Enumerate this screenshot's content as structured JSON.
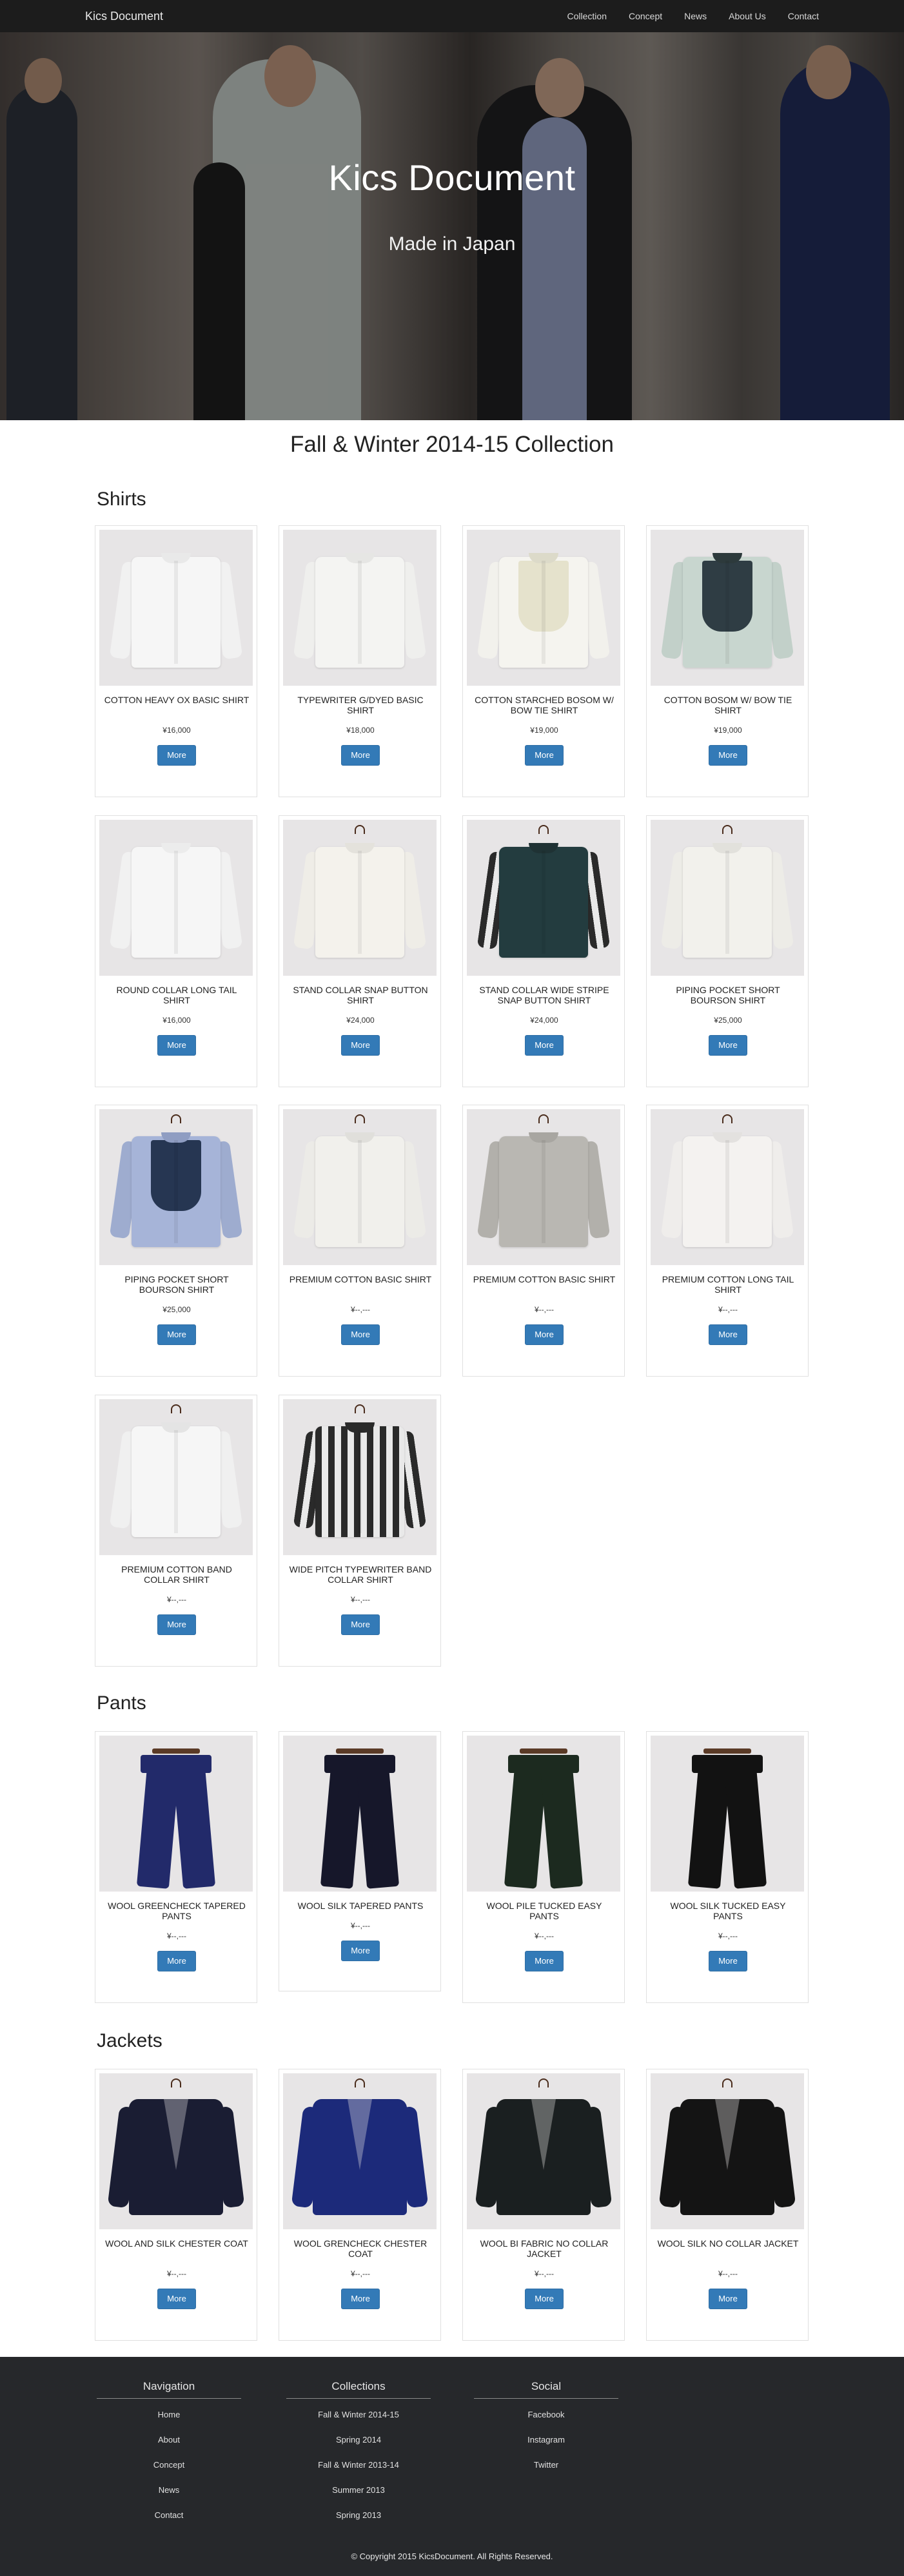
{
  "nav": {
    "brand": "Kics Document",
    "links": [
      "Collection",
      "Concept",
      "News",
      "About Us",
      "Contact"
    ]
  },
  "hero": {
    "title": "Kics Document",
    "subtitle": "Made in Japan"
  },
  "collection_title": "Fall & Winter 2014-15 Collection",
  "sections": {
    "shirts": {
      "heading": "Shirts",
      "items": [
        {
          "name": "COTTON HEAVY OX BASIC SHIRT",
          "price": "¥16,000",
          "button": "More"
        },
        {
          "name": "TYPEWRITER G/DYED BASIC SHIRT",
          "price": "¥18,000",
          "button": "More"
        },
        {
          "name": "COTTON STARCHED BOSOM W/ BOW TIE SHIRT",
          "price": "¥19,000",
          "button": "More"
        },
        {
          "name": "COTTON BOSOM W/ BOW TIE SHIRT",
          "price": "¥19,000",
          "button": "More"
        },
        {
          "name": "ROUND COLLAR LONG TAIL SHIRT",
          "price": "¥16,000",
          "button": "More"
        },
        {
          "name": "STAND COLLAR SNAP BUTTON SHIRT",
          "price": "¥24,000",
          "button": "More"
        },
        {
          "name": "STAND COLLAR WIDE STRIPE SNAP BUTTON SHIRT",
          "price": "¥24,000",
          "button": "More"
        },
        {
          "name": "PIPING POCKET SHORT BOURSON SHIRT",
          "price": "¥25,000",
          "button": "More"
        },
        {
          "name": "PIPING POCKET SHORT BOURSON SHIRT",
          "price": "¥25,000",
          "button": "More"
        },
        {
          "name": "PREMIUM COTTON BASIC SHIRT",
          "price": "¥--,---",
          "button": "More"
        },
        {
          "name": "PREMIUM COTTON BASIC SHIRT",
          "price": "¥--,---",
          "button": "More"
        },
        {
          "name": "PREMIUM COTTON LONG TAIL SHIRT",
          "price": "¥--,---",
          "button": "More"
        },
        {
          "name": "PREMIUM COTTON BAND COLLAR SHIRT",
          "price": "¥--,---",
          "button": "More"
        },
        {
          "name": "WIDE PITCH TYPEWRITER BAND COLLAR SHIRT",
          "price": "¥--,---",
          "button": "More"
        }
      ]
    },
    "pants": {
      "heading": "Pants",
      "items": [
        {
          "name": "WOOL GREENCHECK TAPERED PANTS",
          "price": "¥--,---",
          "button": "More"
        },
        {
          "name": "WOOL SILK TAPERED PANTS",
          "price": "¥--,---",
          "button": "More"
        },
        {
          "name": "WOOL PILE TUCKED EASY PANTS",
          "price": "¥--,---",
          "button": "More"
        },
        {
          "name": "WOOL SILK TUCKED EASY PANTS",
          "price": "¥--,---",
          "button": "More"
        }
      ]
    },
    "jackets": {
      "heading": "Jackets",
      "items": [
        {
          "name": "WOOL AND SILK CHESTER COAT",
          "price": "¥--,---",
          "button": "More"
        },
        {
          "name": "WOOL GRENCHECK CHESTER COAT",
          "price": "¥--,---",
          "button": "More"
        },
        {
          "name": "WOOL BI FABRIC NO COLLAR JACKET",
          "price": "¥--,---",
          "button": "More"
        },
        {
          "name": "WOOL SILK NO COLLAR JACKET",
          "price": "¥--,---",
          "button": "More"
        }
      ]
    }
  },
  "footer": {
    "navigation": {
      "heading": "Navigation",
      "links": [
        "Home",
        "About",
        "Concept",
        "News",
        "Contact"
      ]
    },
    "collections": {
      "heading": "Collections",
      "links": [
        "Fall & Winter 2014-15",
        "Spring 2014",
        "Fall & Winter 2013-14",
        "Summer 2013",
        "Spring 2013"
      ]
    },
    "social": {
      "heading": "Social",
      "links": [
        "Facebook",
        "Instagram",
        "Twitter"
      ]
    },
    "copyright": "© Copyright 2015 KicsDocument. All Rights Reserved."
  },
  "colors": {
    "button": "#337ab7",
    "navbar": "#1c1c1c",
    "footer": "#26282b"
  }
}
